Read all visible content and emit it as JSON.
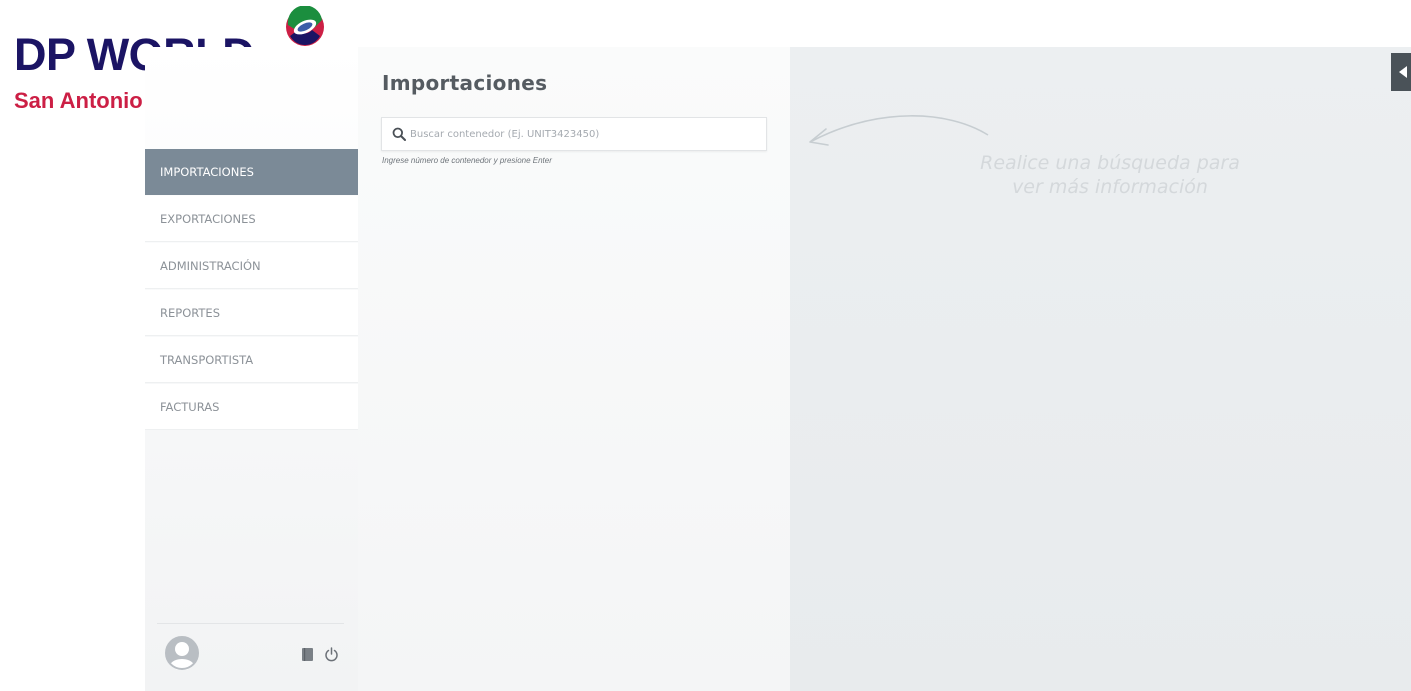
{
  "brand": {
    "name": "DP WORLD",
    "location": "San Antonio",
    "colors": {
      "navy": "#1b1464",
      "red": "#cc1f45"
    }
  },
  "sidebar": {
    "items": [
      {
        "label": "IMPORTACIONES",
        "active": true
      },
      {
        "label": "EXPORTACIONES",
        "active": false
      },
      {
        "label": "ADMINISTRACIÓN",
        "active": false
      },
      {
        "label": "REPORTES",
        "active": false
      },
      {
        "label": "TRANSPORTISTA",
        "active": false
      },
      {
        "label": "FACTURAS",
        "active": false
      }
    ],
    "footer": {
      "avatar_icon": "user-avatar-icon",
      "icons": [
        "document-icon",
        "power-icon"
      ]
    }
  },
  "main": {
    "title": "Importaciones",
    "search": {
      "placeholder": "Buscar contenedor (Ej. UNIT3423450)",
      "value": "",
      "hint": "Ingrese número de contenedor y presione Enter"
    }
  },
  "detail": {
    "placeholder_line1": "Realice una búsqueda para",
    "placeholder_line2": "ver más información"
  },
  "colors": {
    "active_nav": "#7b8a97",
    "detail_bg": "#eceff1"
  }
}
